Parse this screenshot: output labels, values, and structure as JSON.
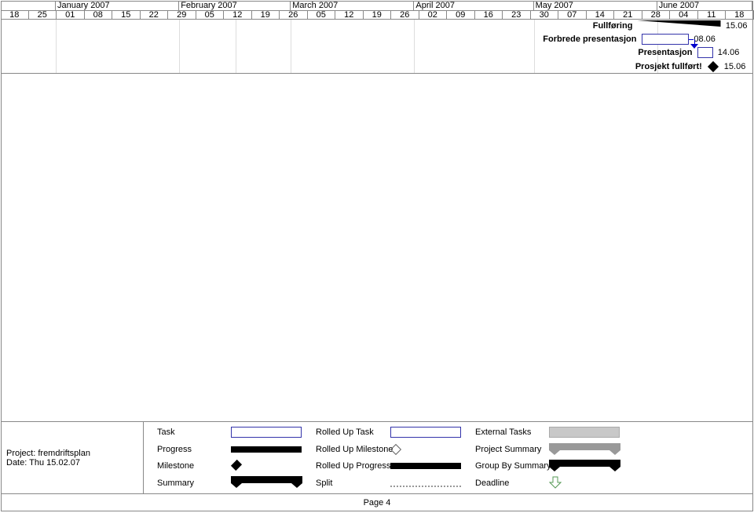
{
  "timescale": {
    "months": [
      {
        "label": "January 2007",
        "start": "2007-01-01"
      },
      {
        "label": "February 2007",
        "start": "2007-02-01"
      },
      {
        "label": "March 2007",
        "start": "2007-03-01"
      },
      {
        "label": "April 2007",
        "start": "2007-04-01"
      },
      {
        "label": "May 2007",
        "start": "2007-05-01"
      },
      {
        "label": "June 2007",
        "start": "2007-06-01"
      }
    ],
    "weeks": [
      "18",
      "25",
      "01",
      "08",
      "15",
      "22",
      "29",
      "05",
      "12",
      "19",
      "26",
      "05",
      "12",
      "19",
      "26",
      "02",
      "09",
      "16",
      "23",
      "30",
      "07",
      "14",
      "21",
      "28",
      "04",
      "11",
      "18"
    ]
  },
  "tasks": [
    {
      "name": "Fullføring",
      "type": "summary",
      "start": "2007-05-27",
      "end": "2007-06-17",
      "date_label": "15.06"
    },
    {
      "name": "Forbrede presentasjon",
      "type": "task",
      "start": "2007-05-28",
      "end": "2007-06-09",
      "date_label": "08.06"
    },
    {
      "name": "Presentasjon",
      "type": "task",
      "start": "2007-06-11",
      "end": "2007-06-15",
      "date_label": "14.06"
    },
    {
      "name": "Prosjekt fullført!",
      "type": "milestone",
      "start": "2007-06-15",
      "date_label": "15.06"
    }
  ],
  "footer": {
    "project": "Project: fremdriftsplan",
    "date": "Date: Thu 15.02.07",
    "page": "Page 4"
  },
  "legend": {
    "task": "Task",
    "progress": "Progress",
    "milestone": "Milestone",
    "summary": "Summary",
    "rolled_up_task": "Rolled Up Task",
    "rolled_up_milestone": "Rolled Up Milestone",
    "rolled_up_progress": "Rolled Up Progress",
    "split": "Split",
    "external_tasks": "External Tasks",
    "project_summary": "Project Summary",
    "group_by_summary": "Group By Summary",
    "deadline": "Deadline"
  },
  "colors": {
    "task_border": "#3333aa",
    "link": "#0000cc",
    "external": "#c8c8c8",
    "project_summary": "#999999",
    "deadline": "#559955"
  }
}
